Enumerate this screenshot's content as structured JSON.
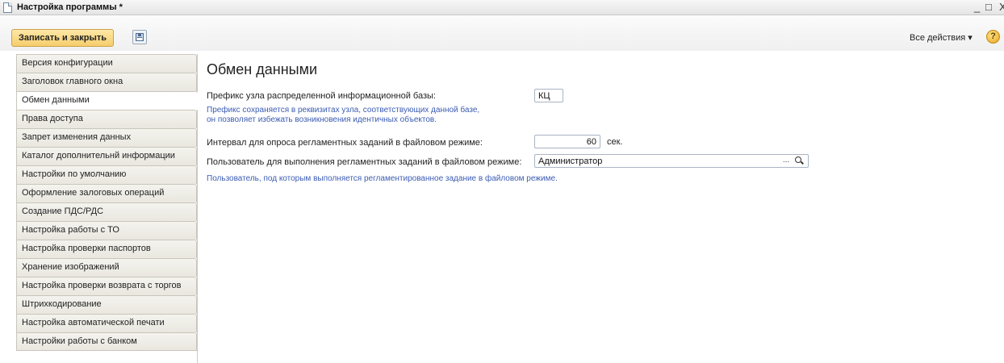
{
  "window": {
    "title": "Настройка программы *",
    "controls": {
      "minimize": "_",
      "maximize": "□",
      "close": "X"
    }
  },
  "toolbar": {
    "save_close_label": "Записать и закрыть",
    "save_icon": "floppy-disk-icon",
    "all_actions_label": "Все действия ▾",
    "help_label": "?"
  },
  "sidebar": {
    "items": [
      {
        "label": "Версия конфигурации"
      },
      {
        "label": "Заголовок главного окна"
      },
      {
        "label": "Обмен данными"
      },
      {
        "label": "Права доступа"
      },
      {
        "label": "Запрет изменения данных"
      },
      {
        "label": "Каталог дополнительнй информации"
      },
      {
        "label": "Настройки по умолчанию"
      },
      {
        "label": "Оформление залоговых операций"
      },
      {
        "label": "Создание ПДС/РДС"
      },
      {
        "label": "Настройка работы с ТО"
      },
      {
        "label": "Настройка проверки паспортов"
      },
      {
        "label": "Хранение изображений"
      },
      {
        "label": "Настройка проверки возврата с торгов"
      },
      {
        "label": "Штрихкодирование"
      },
      {
        "label": "Настройка автоматической печати"
      },
      {
        "label": "Настройки работы с банком"
      }
    ],
    "active_index": 2
  },
  "main": {
    "title": "Обмен данными",
    "prefix_label": "Префикс узла распределенной информационной базы:",
    "prefix_value": "КЦ",
    "prefix_hint_line1": "Префикс сохраняется в реквизитах узла, соответствующих данной базе,",
    "prefix_hint_line2": "он позволяет избежать возникновения идентичных объектов.",
    "interval_label": "Интервал для опроса регламентных заданий в файловом режиме:",
    "interval_value": "60",
    "interval_unit": "сек.",
    "user_label": "Пользователь для выполнения регламентных заданий в файловом режиме:",
    "user_value": "Администратор",
    "user_select_label": "...",
    "user_hint": "Пользователь, под которым выполняется регламентированное задание в файловом режиме."
  },
  "colors": {
    "hint_text": "#3b5cb3",
    "save_button": "#f6cd6c",
    "help_icon": "#e8a51c"
  }
}
